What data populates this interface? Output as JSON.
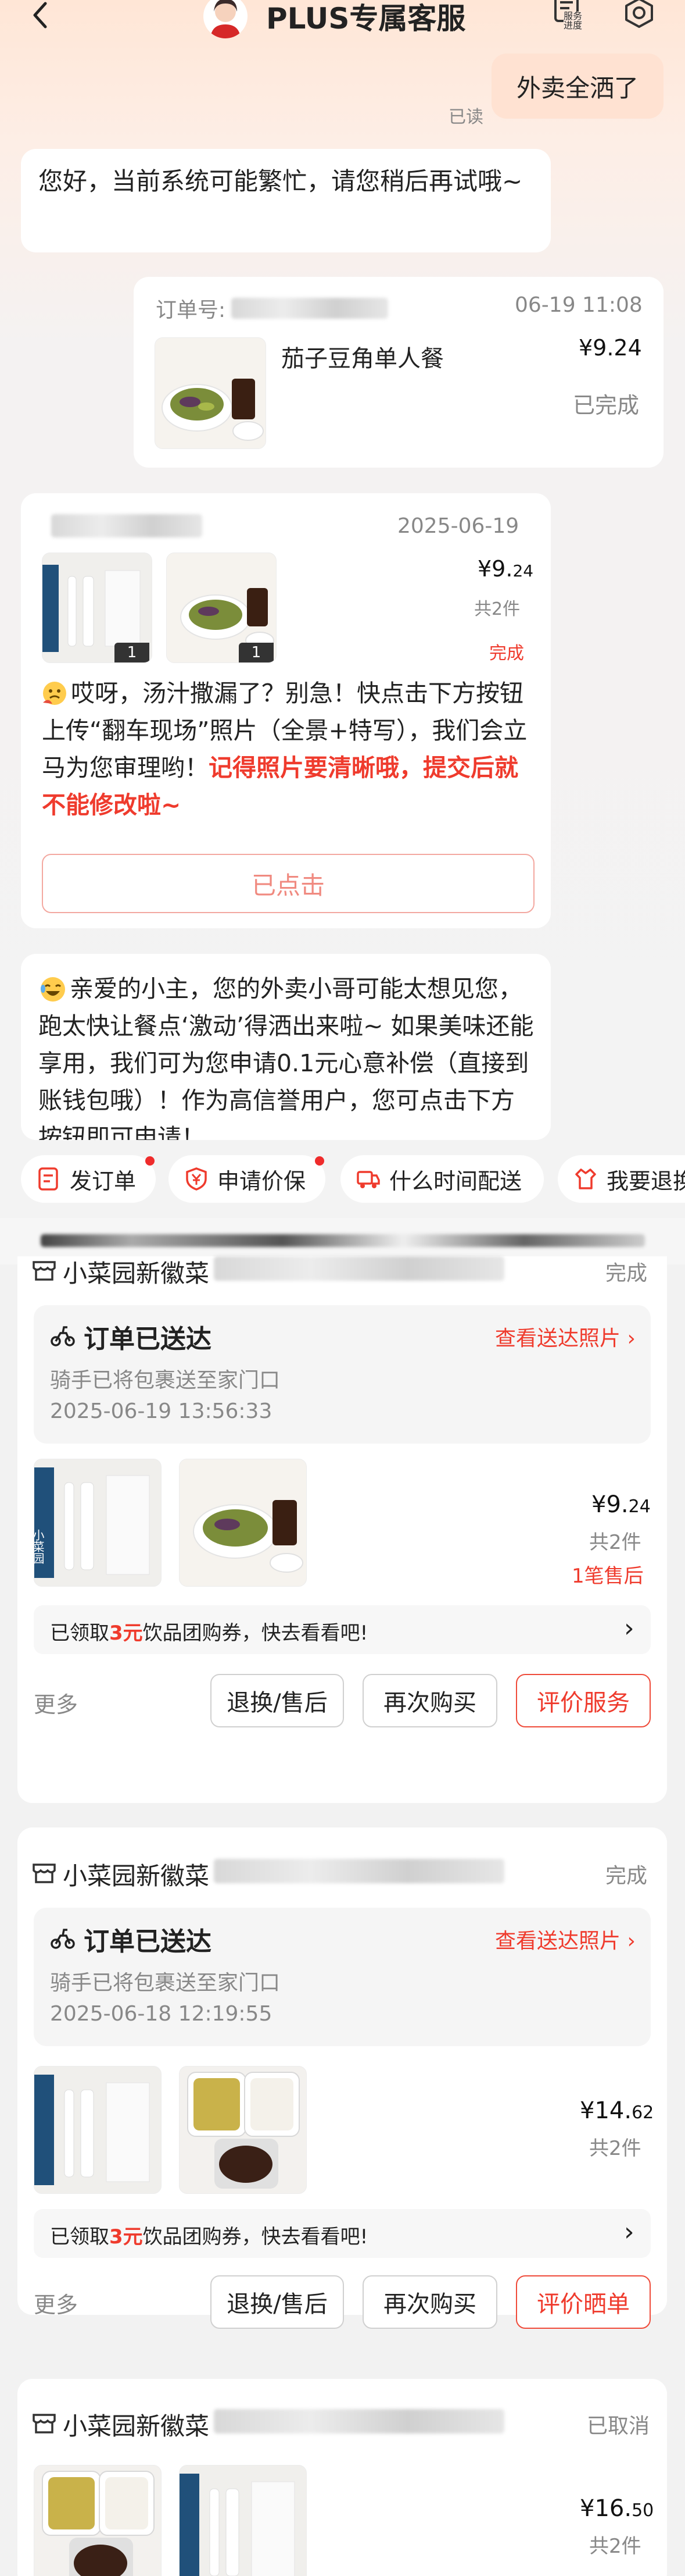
{
  "header": {
    "title": "PLUS专属客服",
    "service_progress": "服务\n进度"
  },
  "chat": {
    "user_message": "外卖全洒了",
    "read_status": "已读",
    "system_busy": "您好，当前系统可能繁忙，请您稍后再试哦~",
    "order_card": {
      "order_label": "订单号:",
      "time": "06-19 11:08",
      "product": "茄子豆角单人餐",
      "price": "¥9.24",
      "status": "已完成"
    },
    "selection_card": {
      "date": "2025-06-19",
      "price_main": "¥9.",
      "price_cents": "24",
      "count": "共2件",
      "status": "完成",
      "badge_1": "1",
      "badge_2": "1",
      "msg_normal": "哎呀，汤汁撒漏了？别急！快点击下方按钮上传“翻车现场”照片（全景+特写），我们会立马为您审理哟！",
      "msg_red": "记得照片要清晰哦，提交后就不能修改啦~",
      "clicked_button": "已点击"
    },
    "compensation_msg": "亲爱的小主，您的外卖小哥可能太想见您，跑太快让餐点‘激动’得洒出来啦~ 如果美味还能享用，我们可为您申请0.1元心意补偿（直接到账钱包哦）！作为高信誉用户，您可点击下方按钮即可申请！",
    "quick_actions": [
      {
        "label": "发订单",
        "icon": "order-icon"
      },
      {
        "label": "申请价保",
        "icon": "yen-shield-icon"
      },
      {
        "label": "什么时间配送",
        "icon": "truck-icon"
      },
      {
        "label": "我要退换",
        "icon": "return-icon"
      }
    ]
  },
  "orders": [
    {
      "shop": "小菜园新徽菜",
      "status": "完成",
      "delivery_title": "订单已送达",
      "delivery_sub": "骑手已将包裹送至家门口",
      "delivery_time": "2025-06-19 13:56:33",
      "view_photos": "查看送达照片",
      "price_main": "¥9.",
      "price_cents": "24",
      "count": "共2件",
      "after_sale": "1笔售后",
      "coupon_pre": "已领取",
      "coupon_amount": "3元",
      "coupon_post": "饮品团购券，快去看看吧!",
      "more": "更多",
      "btn1": "退换/售后",
      "btn2": "再次购买",
      "btn3": "评价服务"
    },
    {
      "shop": "小菜园新徽菜",
      "status": "完成",
      "delivery_title": "订单已送达",
      "delivery_sub": "骑手已将包裹送至家门口",
      "delivery_time": "2025-06-18 12:19:55",
      "view_photos": "查看送达照片",
      "price_main": "¥14.",
      "price_cents": "62",
      "count": "共2件",
      "coupon_pre": "已领取",
      "coupon_amount": "3元",
      "coupon_post": "饮品团购券，快去看看吧!",
      "more": "更多",
      "btn1": "退换/售后",
      "btn2": "再次购买",
      "btn3": "评价晒单"
    },
    {
      "shop": "小菜园新徽菜",
      "status": "已取消",
      "price_main": "¥16.",
      "price_cents": "50",
      "count": "共2件"
    }
  ],
  "thumb_brand": "小菜园",
  "colors": {
    "accent_red": "#ef3b2d",
    "page_bg": "#f3f3f3",
    "header_gradient": "#ffe6d6"
  }
}
